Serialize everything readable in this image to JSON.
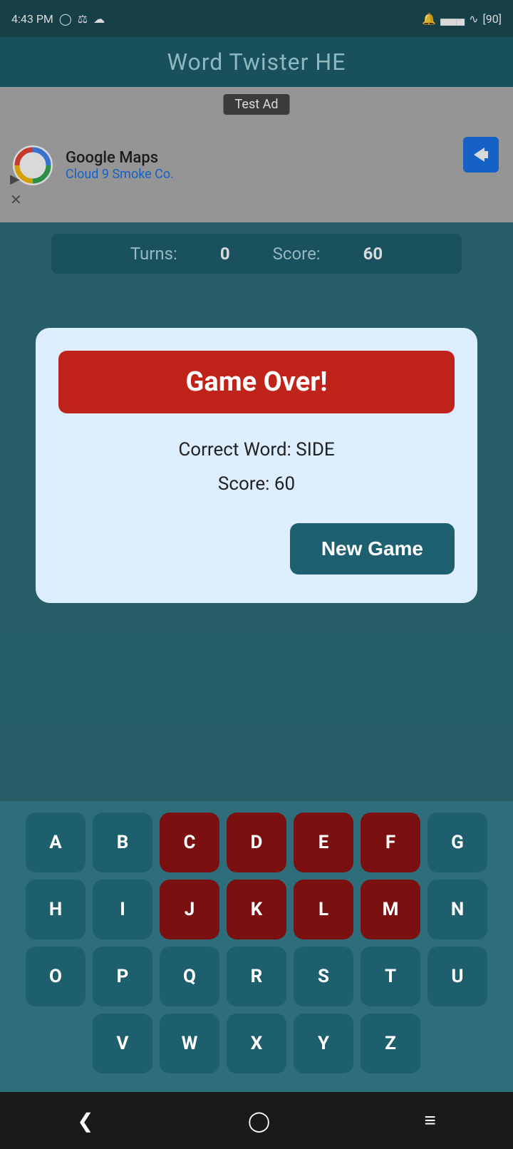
{
  "statusBar": {
    "time": "4:43 PM",
    "battery": "90"
  },
  "appTitle": "Word Twister HE",
  "ad": {
    "label": "Test Ad",
    "company": "Google Maps",
    "subtitle": "Cloud 9 Smoke Co."
  },
  "gameBar": {
    "turnsLabel": "Turns:",
    "turnsValue": "0",
    "scoreLabel": "Score:",
    "scoreValue": "60"
  },
  "dialog": {
    "title": "Game Over!",
    "correctWordLabel": "Correct Word: SIDE",
    "scoreLabel": "Score: 60",
    "newGameButton": "New Game"
  },
  "keyboard": {
    "rows": [
      [
        "A",
        "B",
        "C",
        "D",
        "E",
        "F",
        "G"
      ],
      [
        "H",
        "I",
        "J",
        "K",
        "L",
        "M",
        "N"
      ],
      [
        "O",
        "P",
        "Q",
        "R",
        "S",
        "T",
        "U"
      ],
      [
        "V",
        "W",
        "X",
        "Y",
        "Z"
      ]
    ],
    "darkRedKeys": [
      "C",
      "D",
      "E",
      "F",
      "J",
      "K",
      "L",
      "M"
    ]
  }
}
